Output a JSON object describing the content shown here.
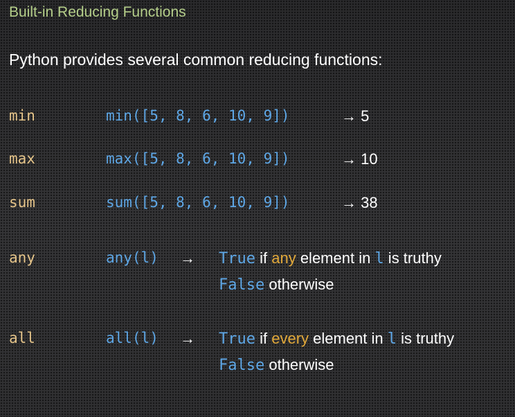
{
  "title": "Built-in Reducing Functions",
  "intro": "Python provides several common reducing functions:",
  "colors": {
    "title": "#b5cf8a",
    "function_name": "#e6c58a",
    "code": "#5ea7e6",
    "highlight": "#e2a93a",
    "text": "#ffffff"
  },
  "functions": [
    {
      "name": "min",
      "example": "min([5, 8, 6, 10, 9])",
      "result": "→ 5"
    },
    {
      "name": "max",
      "example": "max([5, 8, 6, 10, 9])",
      "result": "→ 10"
    },
    {
      "name": "sum",
      "example": "sum([5, 8, 6, 10, 9])",
      "result": "→ 38"
    }
  ],
  "predicates": [
    {
      "name": "any",
      "call": "any(l)",
      "arrow": "→",
      "true_kw": "True",
      "text_if": " if ",
      "quantifier": "any",
      "text_elem": " element in ",
      "var": "l",
      "text_truthy": " is truthy",
      "false_kw": "False",
      "text_otherwise": " otherwise"
    },
    {
      "name": "all",
      "call": "all(l)",
      "arrow": "→",
      "true_kw": "True",
      "text_if": " if ",
      "quantifier": "every",
      "text_elem": " element in ",
      "var": "l",
      "text_truthy": " is truthy",
      "false_kw": "False",
      "text_otherwise": " otherwise"
    }
  ]
}
